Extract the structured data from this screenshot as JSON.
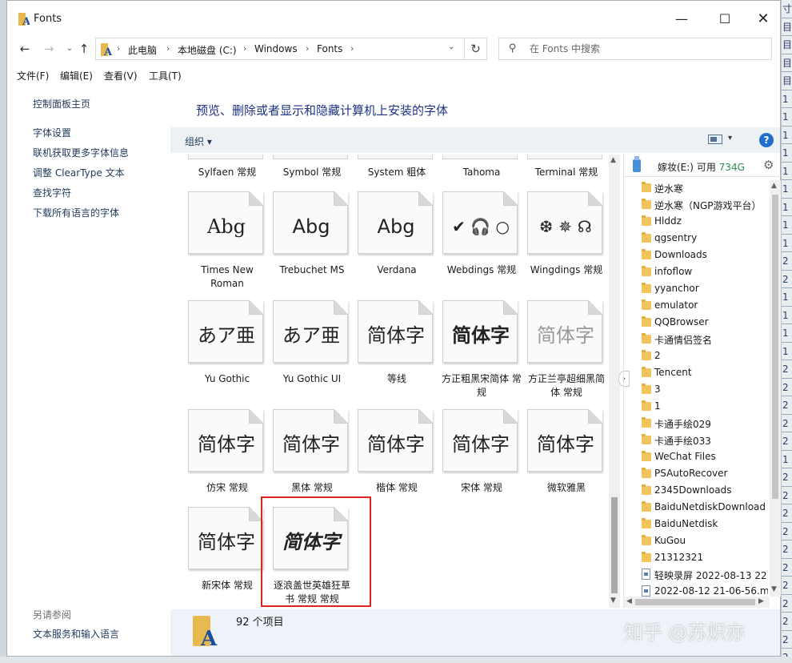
{
  "window": {
    "title": "Fonts",
    "controls": {
      "minimize": "—",
      "maximize": "☐",
      "close": "✕"
    }
  },
  "nav": {
    "back": "←",
    "forward": "→",
    "recent": "⌄",
    "up": "↑",
    "breadcrumb": [
      "此电脑",
      "本地磁盘 (C:)",
      "Windows",
      "Fonts"
    ],
    "refresh": "↻",
    "search_placeholder": "在 Fonts 中搜索"
  },
  "menu": [
    "文件(F)",
    "编辑(E)",
    "查看(V)",
    "工具(T)"
  ],
  "left_panel": {
    "home": "控制面板主页",
    "links": [
      "字体设置",
      "联机获取更多字体信息",
      "调整 ClearType 文本",
      "查找字符",
      "下载所有语言的字体"
    ],
    "see_also_title": "另请参阅",
    "see_also": [
      "文本服务和输入语言"
    ]
  },
  "heading": "预览、删除或者显示和隐藏计算机上安装的字体",
  "toolbar": {
    "organize": "组织 ▾",
    "view_drop": "▾",
    "help": "?"
  },
  "fonts": {
    "row0": [
      "Sylfaen 常规",
      "Symbol 常规",
      "System 粗体",
      "Tahoma",
      "Terminal 常规"
    ],
    "row1": [
      {
        "sample": "Abg",
        "name": "Times New Roman"
      },
      {
        "sample": "Abg",
        "name": "Trebuchet MS"
      },
      {
        "sample": "Abg",
        "name": "Verdana"
      },
      {
        "sample": "✔ 🎧 ○",
        "name": "Webdings 常规"
      },
      {
        "sample": "❆ ✵ ☊",
        "name": "Wingdings 常规"
      }
    ],
    "row2": [
      {
        "sample": "あア亜",
        "name": "Yu Gothic"
      },
      {
        "sample": "あア亜",
        "name": "Yu Gothic UI"
      },
      {
        "sample": "简体字",
        "name": "等线"
      },
      {
        "sample": "简体字",
        "name": "方正粗黑宋简体 常规"
      },
      {
        "sample": "简体字",
        "name": "方正兰亭超细黑简体 常规"
      }
    ],
    "row3": [
      {
        "sample": "简体字",
        "name": "仿宋 常规"
      },
      {
        "sample": "简体字",
        "name": "黑体 常规"
      },
      {
        "sample": "简体字",
        "name": "楷体 常规"
      },
      {
        "sample": "简体字",
        "name": "宋体 常规"
      },
      {
        "sample": "简体字",
        "name": "微软雅黑"
      }
    ],
    "row4": [
      {
        "sample": "简体字",
        "name": "新宋体 常规"
      },
      {
        "sample": "简体字",
        "name": "逐浪盖世英雄狂草书 常规 常规"
      }
    ]
  },
  "right_panel": {
    "drive": "嫁妆(E:)",
    "free_label": "可用",
    "free_value": "734G",
    "items": [
      {
        "type": "folder",
        "name": "逆水寒"
      },
      {
        "type": "folder",
        "name": "逆水寒（NGP游戏平台）"
      },
      {
        "type": "folder",
        "name": "Hlddz"
      },
      {
        "type": "folder",
        "name": "qgsentry"
      },
      {
        "type": "folder",
        "name": "Downloads"
      },
      {
        "type": "folder",
        "name": "infoflow"
      },
      {
        "type": "folder",
        "name": "yyanchor"
      },
      {
        "type": "folder",
        "name": "emulator"
      },
      {
        "type": "folder",
        "name": "QQBrowser"
      },
      {
        "type": "folder",
        "name": "卡通情侣签名"
      },
      {
        "type": "folder",
        "name": "2"
      },
      {
        "type": "folder",
        "name": "Tencent"
      },
      {
        "type": "folder",
        "name": "3"
      },
      {
        "type": "folder",
        "name": "1"
      },
      {
        "type": "folder",
        "name": "卡通手绘029"
      },
      {
        "type": "folder",
        "name": "卡通手绘033"
      },
      {
        "type": "folder",
        "name": "WeChat Files"
      },
      {
        "type": "folder",
        "name": "PSAutoRecover"
      },
      {
        "type": "folder",
        "name": "2345Downloads"
      },
      {
        "type": "folder",
        "name": "BaiduNetdiskDownload"
      },
      {
        "type": "folder",
        "name": "BaiduNetdisk"
      },
      {
        "type": "folder",
        "name": "KuGou"
      },
      {
        "type": "folder",
        "name": "21312321"
      },
      {
        "type": "file",
        "name": "轻映录屏 2022-08-13 22..."
      },
      {
        "type": "file",
        "name": "2022-08-12 21-06-56.m..."
      }
    ]
  },
  "status": {
    "count": "92 个项目"
  },
  "watermark": "知乎 @苏炽亦",
  "desktop_strip": [
    "寸",
    "目",
    "目",
    "目",
    "目",
    "1",
    "1",
    "1",
    "1",
    "1",
    "1",
    "1",
    "1",
    "1",
    "2",
    "2",
    "1",
    "1",
    "1",
    "1",
    "2",
    "2",
    "2",
    "2",
    "2",
    "1",
    "2",
    "2",
    "2",
    "2",
    "2",
    "2",
    "2",
    "2",
    "2",
    "2",
    "2"
  ],
  "colors": {
    "accent": "#1e3287",
    "highlight": "#d9251d",
    "free_space": "#2e8b57"
  }
}
